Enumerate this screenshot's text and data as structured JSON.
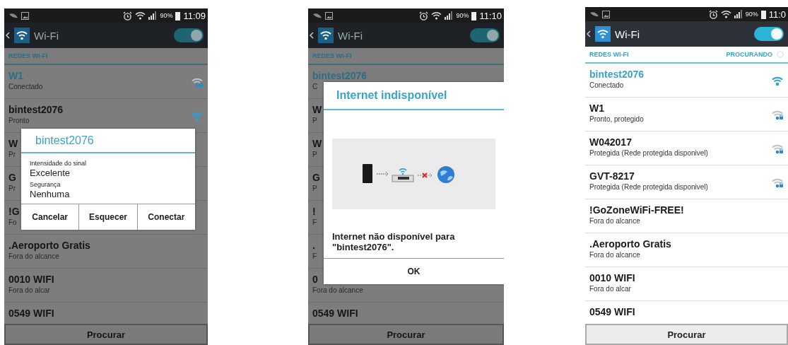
{
  "phones": [
    {
      "status_bar": {
        "battery": "90%",
        "time": "11:09"
      },
      "app_bar": {
        "title": "Wi-Fi",
        "switch": {
          "on": true
        }
      },
      "section": {
        "title": "REDES WI-FI"
      },
      "networks": [
        {
          "name": "W1",
          "status": "Conectado",
          "connected": true,
          "kind": "secured"
        },
        {
          "name": "bintest2076",
          "status": "Pronto",
          "connected": false,
          "kind": "open"
        },
        {
          "name": "W",
          "status": "Pr",
          "connected": false
        },
        {
          "name": "G",
          "status": "Pr",
          "connected": false
        },
        {
          "name": "!G",
          "status": "Fo",
          "connected": false
        },
        {
          "name": ".Aeroporto Gratis",
          "status": "Fora do alcance",
          "connected": false
        },
        {
          "name": "0010 WIFI",
          "status": "Fora do alcar",
          "connected": false
        },
        {
          "name": "0549 WIFI",
          "connected": false
        }
      ],
      "scan_button": "Procurar",
      "dialog": {
        "kind": "details",
        "title": "bintest2076",
        "fields": [
          {
            "label": "Intensidade do sinal",
            "value": "Excelente"
          },
          {
            "label": "Segurança",
            "value": "Nenhuma"
          }
        ],
        "buttons": [
          "Cancelar",
          "Esquecer",
          "Conectar"
        ]
      }
    },
    {
      "status_bar": {
        "battery": "90%",
        "time": "11:10"
      },
      "app_bar": {
        "title": "Wi-Fi",
        "switch": {
          "on": true
        }
      },
      "section": {
        "title": "REDES WI-FI"
      },
      "networks": [
        {
          "name": "bintest2076",
          "status": "C",
          "connected": true
        },
        {
          "name": "W",
          "status": "P",
          "connected": false
        },
        {
          "name": "W",
          "status": "P",
          "connected": false
        },
        {
          "name": "G",
          "status": "P",
          "connected": false
        },
        {
          "name": "!",
          "status": "F",
          "connected": false
        },
        {
          "name": ".",
          "status": "F",
          "connected": false
        },
        {
          "name": "0",
          "status": "Fora do alcance",
          "connected": false
        },
        {
          "name": "0549 WIFI",
          "connected": false
        }
      ],
      "scan_button": "Procurar",
      "dialog": {
        "kind": "alert",
        "title": "Internet indisponível",
        "message": "Internet não disponível para \"bintest2076\".",
        "buttons": [
          "OK"
        ]
      }
    },
    {
      "status_bar": {
        "battery": "90%",
        "time": "11:0"
      },
      "app_bar": {
        "title": "Wi-Fi",
        "switch": {
          "on": true
        }
      },
      "section": {
        "title": "REDES WI-FI",
        "status": "PROCURANDO"
      },
      "networks": [
        {
          "name": "bintest2076",
          "status": "Conectado",
          "connected": true,
          "kind": "open"
        },
        {
          "name": "W1",
          "status": "Pronto, protegido",
          "connected": false,
          "kind": "secured"
        },
        {
          "name": "W042017",
          "status": "Protegida (Rede protegida disponivel)",
          "connected": false,
          "kind": "secured"
        },
        {
          "name": "GVT-8217",
          "status": "Protegida (Rede protegida disponivel)",
          "connected": false,
          "kind": "secured"
        },
        {
          "name": "!GoZoneWiFi-FREE!",
          "status": "Fora do alcance",
          "connected": false
        },
        {
          "name": ".Aeroporto Gratis",
          "status": "Fora do alcance",
          "connected": false
        },
        {
          "name": "0010 WIFI",
          "status": "Fora do alcar",
          "connected": false
        },
        {
          "name": "0549 WIFI",
          "connected": false
        }
      ],
      "scan_button": "Procurar"
    }
  ]
}
